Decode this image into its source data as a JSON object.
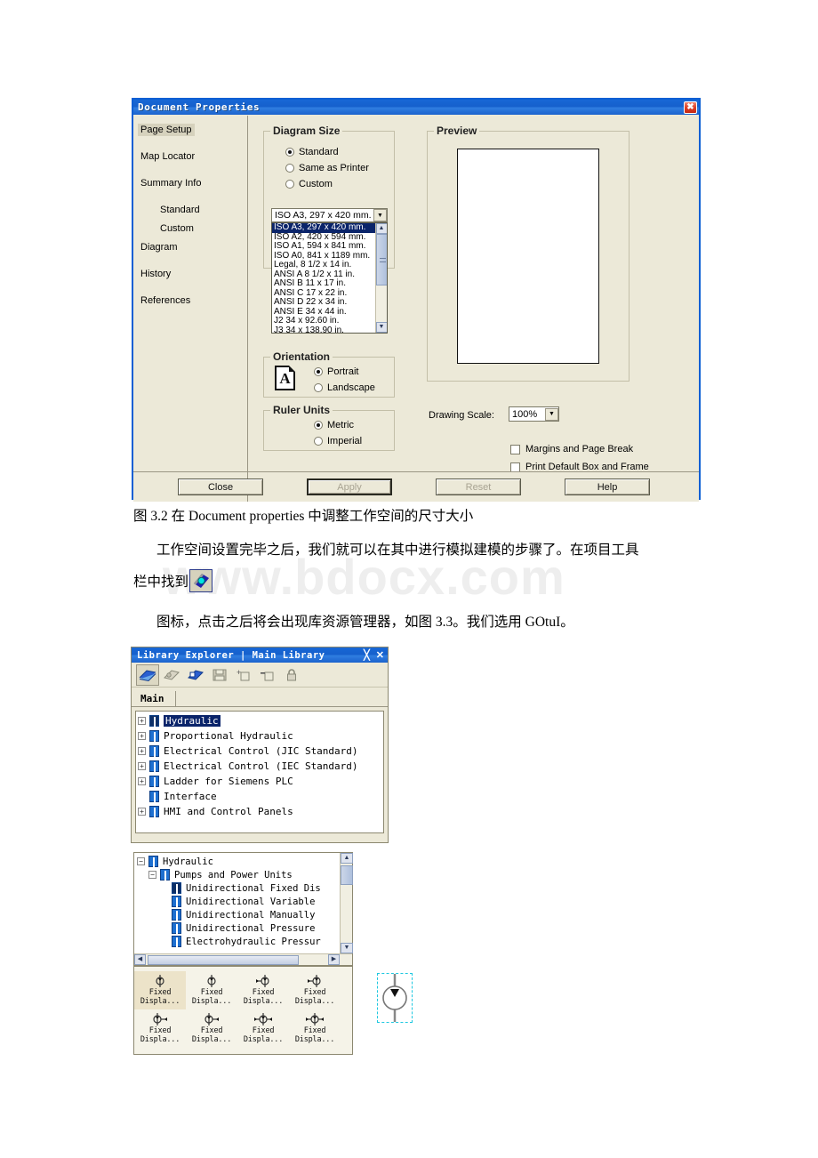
{
  "watermark": "www.bdocx.com",
  "dialog": {
    "title": "Document Properties",
    "close_icon": "close-icon",
    "nav": [
      {
        "label": "Page Setup",
        "selected": true
      },
      {
        "label": "Map Locator",
        "selected": false
      },
      {
        "label": "Summary Info",
        "selected": false
      },
      {
        "label": "Standard",
        "selected": false
      },
      {
        "label": "Custom",
        "selected": false
      },
      {
        "label": "Diagram",
        "selected": false
      },
      {
        "label": "History",
        "selected": false
      },
      {
        "label": "References",
        "selected": false
      }
    ],
    "diagram_size": {
      "legend": "Diagram Size",
      "options": [
        {
          "label": "Standard",
          "selected": true
        },
        {
          "label": "Same as Printer",
          "selected": false
        },
        {
          "label": "Custom",
          "selected": false
        }
      ],
      "combo_value": "ISO A3, 297 x 420 mm.",
      "list_items": [
        "ISO A3, 297 x 420 mm.",
        "ISO A2, 420 x 594 mm.",
        "ISO A1, 594 x 841 mm.",
        "ISO A0, 841 x 1189 mm.",
        "Legal, 8 1/2 x 14 in.",
        "ANSI A 8 1/2 x 11 in.",
        "ANSI B 11 x 17 in.",
        "ANSI C 17 x 22 in.",
        "ANSI D 22 x 34 in.",
        "ANSI E 34 x 44 in.",
        "J2   34 x  92.60 in.",
        "J3   34 x 138.90 in."
      ],
      "selected_index": 0
    },
    "orientation": {
      "legend": "Orientation",
      "page_glyph": "A",
      "options": [
        {
          "label": "Portrait",
          "selected": true
        },
        {
          "label": "Landscape",
          "selected": false
        }
      ]
    },
    "ruler_units": {
      "legend": "Ruler Units",
      "options": [
        {
          "label": "Metric",
          "selected": true
        },
        {
          "label": "Imperial",
          "selected": false
        }
      ]
    },
    "preview": {
      "legend": "Preview"
    },
    "drawing_scale": {
      "label": "Drawing Scale:",
      "value": "100%"
    },
    "checkboxes": [
      {
        "label": "Margins and Page Break",
        "checked": false
      },
      {
        "label": "Print Default Box and Frame",
        "checked": false
      }
    ],
    "buttons": [
      {
        "label": "Close",
        "enabled": true
      },
      {
        "label": "Apply",
        "enabled": false
      },
      {
        "label": "Reset",
        "enabled": false
      },
      {
        "label": "Help",
        "enabled": true
      }
    ]
  },
  "body_text": {
    "caption": "图 3.2 在 Document properties 中调整工作空间的尺寸大小",
    "para1_line1": "工作空间设置完毕之后，我们就可以在其中进行模拟建模的步骤了。在项目工具",
    "para1_line2_prefix": "栏中找到",
    "para2": "图标，点击之后将会出现库资源管理器，如图 3.3。我们选用 GOtuI。"
  },
  "library_explorer": {
    "title": "Library Explorer | Main Library",
    "pin_icon": "pin-icon",
    "close_icon": "close-icon",
    "toolbar": [
      {
        "name": "open-library-icon",
        "active": true
      },
      {
        "name": "new-library-icon",
        "active": false
      },
      {
        "name": "edit-library-icon",
        "active": false
      },
      {
        "name": "save-library-icon",
        "active": false
      },
      {
        "name": "add-item-icon",
        "active": false
      },
      {
        "name": "remove-item-icon",
        "active": false
      },
      {
        "name": "lock-icon",
        "active": false
      }
    ],
    "tab": "Main",
    "tree": [
      {
        "label": "Hydraulic",
        "expander": "+",
        "selected": true,
        "icon": "dark"
      },
      {
        "label": "Proportional Hydraulic",
        "expander": "+",
        "selected": false,
        "icon": "blue"
      },
      {
        "label": "Electrical Control (JIC Standard)",
        "expander": "+",
        "selected": false,
        "icon": "blue"
      },
      {
        "label": "Electrical Control (IEC Standard)",
        "expander": "+",
        "selected": false,
        "icon": "blue"
      },
      {
        "label": "Ladder for Siemens PLC",
        "expander": "+",
        "selected": false,
        "icon": "blue"
      },
      {
        "label": "Interface",
        "expander": "",
        "selected": false,
        "icon": "blue"
      },
      {
        "label": "HMI and Control Panels",
        "expander": "+",
        "selected": false,
        "icon": "blue"
      }
    ]
  },
  "library_tree2": {
    "rows": [
      {
        "label": "Hydraulic",
        "expander": "−",
        "indent": 0,
        "icon": "blue",
        "selected": false
      },
      {
        "label": "Pumps and Power Units",
        "expander": "−",
        "indent": 1,
        "icon": "blue",
        "selected": false
      },
      {
        "label": "Unidirectional Fixed Dis",
        "expander": "",
        "indent": 2,
        "icon": "dark",
        "selected": false
      },
      {
        "label": "Unidirectional Variable",
        "expander": "",
        "indent": 2,
        "icon": "blue",
        "selected": false
      },
      {
        "label": "Unidirectional Manually",
        "expander": "",
        "indent": 2,
        "icon": "blue",
        "selected": false
      },
      {
        "label": "Unidirectional Pressure",
        "expander": "",
        "indent": 2,
        "icon": "blue",
        "selected": false
      },
      {
        "label": "Electrohydraulic Pressur",
        "expander": "",
        "indent": 2,
        "icon": "blue",
        "selected": false
      }
    ]
  },
  "icon_grid": {
    "cells": [
      {
        "label1": "Fixed",
        "label2": "Displa...",
        "symbol": "pump-up",
        "selected": true
      },
      {
        "label1": "Fixed",
        "label2": "Displa...",
        "symbol": "pump-up",
        "selected": false
      },
      {
        "label1": "Fixed",
        "label2": "Displa...",
        "symbol": "pump-up-left",
        "selected": false
      },
      {
        "label1": "Fixed",
        "label2": "Displa...",
        "symbol": "pump-up-left",
        "selected": false
      },
      {
        "label1": "Fixed",
        "label2": "Displa...",
        "symbol": "pump-right",
        "selected": false
      },
      {
        "label1": "Fixed",
        "label2": "Displa...",
        "symbol": "pump-right",
        "selected": false
      },
      {
        "label1": "Fixed",
        "label2": "Displa...",
        "symbol": "pump-right-2",
        "selected": false
      },
      {
        "label1": "Fixed",
        "label2": "Displa...",
        "symbol": "pump-right-2",
        "selected": false
      }
    ]
  },
  "canvas": {
    "selected_symbol": "hydraulic-pump-symbol",
    "selection_color": "#1ec8e0"
  }
}
